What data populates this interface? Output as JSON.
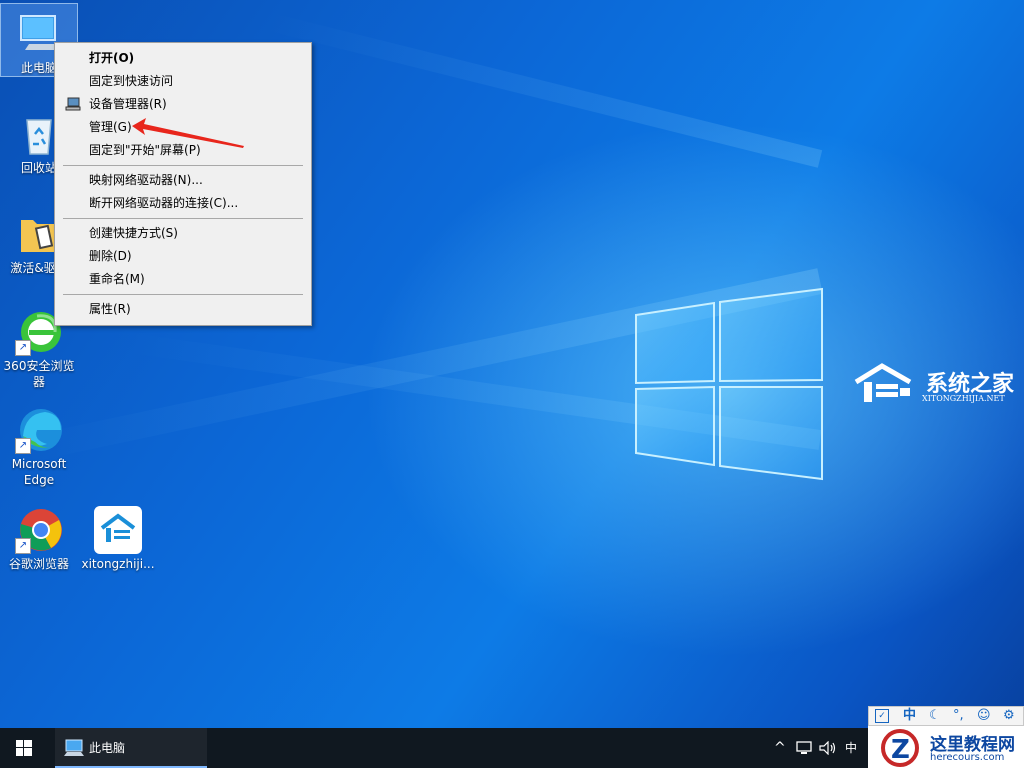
{
  "desktop": {
    "icons": [
      {
        "label": "此电脑",
        "name": "this-pc"
      },
      {
        "label": "回收站",
        "name": "recycle-bin"
      },
      {
        "label": "激活&驱动",
        "name": "activation-folder"
      },
      {
        "label": "360安全浏览器",
        "name": "360-browser"
      },
      {
        "label": "Microsoft Edge",
        "name": "edge"
      },
      {
        "label": "谷歌浏览器",
        "name": "chrome"
      },
      {
        "label": "xitongzhiji...",
        "name": "xitongzhijia"
      }
    ]
  },
  "context_menu": {
    "items": [
      {
        "label": "打开(O)",
        "bold": true
      },
      {
        "label": "固定到快速访问"
      },
      {
        "label": "设备管理器(R)"
      },
      {
        "label": "管理(G)"
      },
      {
        "label": "固定到\"开始\"屏幕(P)"
      },
      {
        "label": "映射网络驱动器(N)..."
      },
      {
        "label": "断开网络驱动器的连接(C)..."
      },
      {
        "label": "创建快捷方式(S)"
      },
      {
        "label": "删除(D)"
      },
      {
        "label": "重命名(M)"
      },
      {
        "label": "属性(R)"
      }
    ]
  },
  "watermark_logo": {
    "title": "系统之家",
    "subtitle": "XITONGZHIJIA.NET"
  },
  "taskbar": {
    "start_icon": "windows-logo-icon",
    "open_window": "此电脑",
    "tray": {
      "ime": "中"
    }
  },
  "corner_watermark": {
    "ime_bar": "中",
    "title": "这里教程网",
    "url": "herecours.com"
  },
  "colors": {
    "taskbar": "#101820",
    "menu_bg": "#f0f0f0",
    "arrow": "#e8261c"
  }
}
